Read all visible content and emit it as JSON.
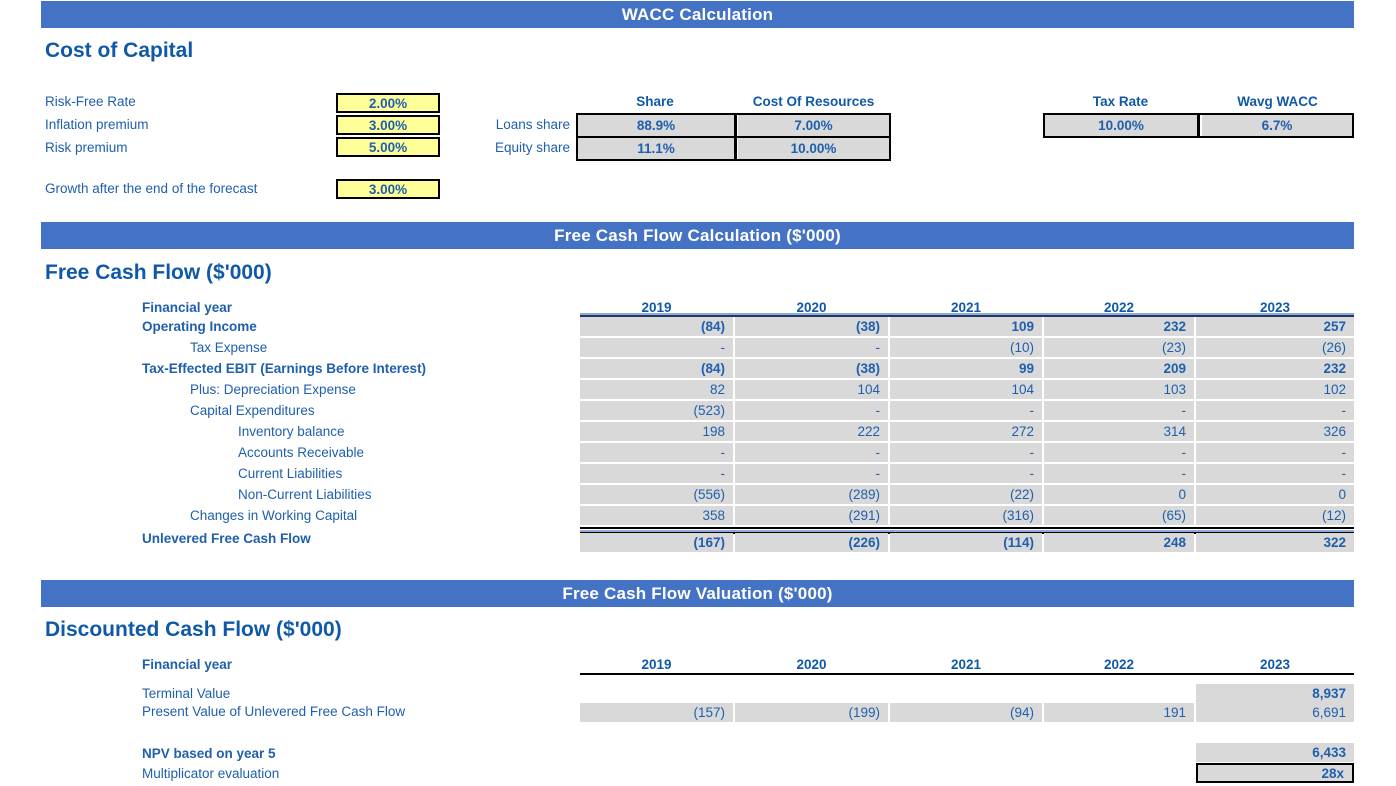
{
  "sections": {
    "wacc_banner": "WACC Calculation",
    "fcf_banner": "Free Cash Flow Calculation ($'000)",
    "val_banner": "Free Cash Flow Valuation ($'000)",
    "cost_of_capital_title": "Cost of Capital",
    "fcf_title": "Free Cash Flow ($'000)",
    "dcf_title": "Discounted Cash Flow ($'000)"
  },
  "cost_of_capital": {
    "inputs": [
      {
        "label": "Risk-Free Rate",
        "value": "2.00%"
      },
      {
        "label": "Inflation premium",
        "value": "3.00%"
      },
      {
        "label": "Risk premium",
        "value": "5.00%"
      }
    ],
    "growth": {
      "label": "Growth after the end of the forecast",
      "value": "3.00%"
    },
    "capital_table": {
      "headers": [
        "Share",
        "Cost Of Resources"
      ],
      "rows": [
        {
          "label": "Loans share",
          "share": "88.9%",
          "cost": "7.00%"
        },
        {
          "label": "Equity share",
          "share": "11.1%",
          "cost": "10.00%"
        }
      ]
    },
    "wacc_table": {
      "headers": [
        "Tax Rate",
        "Wavg WACC"
      ],
      "values": [
        "10.00%",
        "6.7%"
      ]
    }
  },
  "free_cash_flow": {
    "row_header_label": "Financial year",
    "years": [
      "2019",
      "2020",
      "2021",
      "2022",
      "2023"
    ],
    "rows": [
      {
        "label": "Operating Income",
        "indent": 0,
        "bold": true,
        "values": [
          "(84)",
          "(38)",
          "109",
          "232",
          "257"
        ]
      },
      {
        "label": "Tax Expense",
        "indent": 1,
        "bold": false,
        "values": [
          "-",
          "-",
          "(10)",
          "(23)",
          "(26)"
        ]
      },
      {
        "label": "Tax-Effected EBIT (Earnings Before Interest)",
        "indent": 0,
        "bold": true,
        "values": [
          "(84)",
          "(38)",
          "99",
          "209",
          "232"
        ]
      },
      {
        "label": "Plus: Depreciation Expense",
        "indent": 1,
        "bold": false,
        "values": [
          "82",
          "104",
          "104",
          "103",
          "102"
        ]
      },
      {
        "label": "Capital Expenditures",
        "indent": 1,
        "bold": false,
        "values": [
          "(523)",
          "-",
          "-",
          "-",
          "-"
        ]
      },
      {
        "label": "Inventory balance",
        "indent": 2,
        "bold": false,
        "values": [
          "198",
          "222",
          "272",
          "314",
          "326"
        ]
      },
      {
        "label": "Accounts Receivable",
        "indent": 2,
        "bold": false,
        "values": [
          "-",
          "-",
          "-",
          "-",
          "-"
        ]
      },
      {
        "label": "Current Liabilities",
        "indent": 2,
        "bold": false,
        "values": [
          "-",
          "-",
          "-",
          "-",
          "-"
        ]
      },
      {
        "label": "Non-Current Liabilities",
        "indent": 2,
        "bold": false,
        "values": [
          "(556)",
          "(289)",
          "(22)",
          "0",
          "0"
        ]
      },
      {
        "label": "Changes in Working Capital",
        "indent": 1,
        "bold": false,
        "values": [
          "358",
          "(291)",
          "(316)",
          "(65)",
          "(12)"
        ]
      }
    ],
    "total": {
      "label": "Unlevered Free Cash Flow",
      "values": [
        "(167)",
        "(226)",
        "(114)",
        "248",
        "322"
      ]
    }
  },
  "discounted_cash_flow": {
    "row_header_label": "Financial year",
    "years": [
      "2019",
      "2020",
      "2021",
      "2022",
      "2023"
    ],
    "terminal_value": {
      "label": "Terminal Value",
      "values": [
        "",
        "",
        "",
        "",
        "8,937"
      ]
    },
    "pv_ufcf": {
      "label": "Present Value of Unlevered Free Cash Flow",
      "values": [
        "(157)",
        "(199)",
        "(94)",
        "191",
        "6,691"
      ]
    },
    "npv": {
      "label": "NPV based on year 5",
      "value": "6,433"
    },
    "multiplicator": {
      "label": "Multiplicator evaluation",
      "value": "28x"
    }
  },
  "colors": {
    "banner_blue": "#4472c4",
    "title_blue": "#1059a8",
    "text_blue": "#1f5fad",
    "input_yellow": "#ffff99",
    "cell_grey": "#d9d9d9"
  }
}
